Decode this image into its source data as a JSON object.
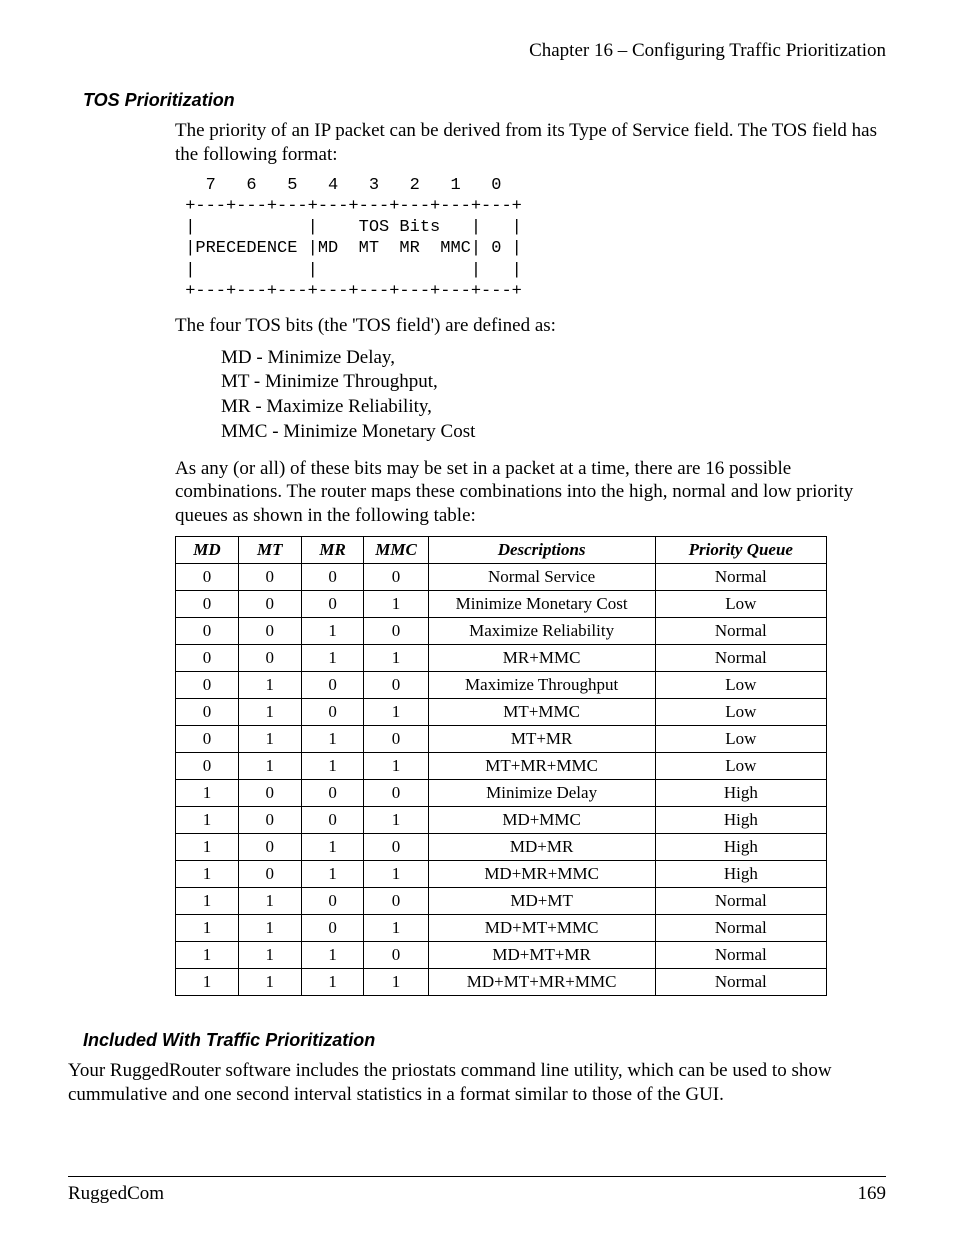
{
  "header": {
    "chapter": "Chapter 16 – Configuring Traffic Prioritization"
  },
  "section1": {
    "title": "TOS Prioritization",
    "p1": "The priority of an IP packet can be derived from its Type of Service field. The TOS field has the following format:",
    "ascii": "   7   6   5   4   3   2   1   0\n +---+---+---+---+---+---+---+---+\n |           |    TOS Bits   |   |\n |PRECEDENCE |MD  MT  MR  MMC| 0 |\n |           |               |   |\n +---+---+---+---+---+---+---+---+",
    "p2": "The four TOS bits (the 'TOS field') are defined as:",
    "defs": {
      "l1": "MD - Minimize Delay,",
      "l2": "MT - Minimize Throughput,",
      "l3": "MR - Maximize Reliability,",
      "l4": "MMC - Minimize Monetary Cost"
    },
    "p3": "As any (or all) of these bits may be set in a packet at a time, there are 16 possible combinations.  The router maps these combinations into the high, normal and low priority queues as shown in the following table:"
  },
  "table": {
    "headers": {
      "md": "MD",
      "mt": "MT",
      "mr": "MR",
      "mmc": "MMC",
      "desc": "Descriptions",
      "pq": "Priority Queue"
    },
    "rows": [
      {
        "md": "0",
        "mt": "0",
        "mr": "0",
        "mmc": "0",
        "desc": "Normal Service",
        "pq": "Normal"
      },
      {
        "md": "0",
        "mt": "0",
        "mr": "0",
        "mmc": "1",
        "desc": "Minimize Monetary Cost",
        "pq": "Low"
      },
      {
        "md": "0",
        "mt": "0",
        "mr": "1",
        "mmc": "0",
        "desc": "Maximize Reliability",
        "pq": "Normal"
      },
      {
        "md": "0",
        "mt": "0",
        "mr": "1",
        "mmc": "1",
        "desc": "MR+MMC",
        "pq": "Normal"
      },
      {
        "md": "0",
        "mt": "1",
        "mr": "0",
        "mmc": "0",
        "desc": "Maximize Throughput",
        "pq": "Low"
      },
      {
        "md": "0",
        "mt": "1",
        "mr": "0",
        "mmc": "1",
        "desc": "MT+MMC",
        "pq": "Low"
      },
      {
        "md": "0",
        "mt": "1",
        "mr": "1",
        "mmc": "0",
        "desc": "MT+MR",
        "pq": "Low"
      },
      {
        "md": "0",
        "mt": "1",
        "mr": "1",
        "mmc": "1",
        "desc": "MT+MR+MMC",
        "pq": "Low"
      },
      {
        "md": "1",
        "mt": "0",
        "mr": "0",
        "mmc": "0",
        "desc": "Minimize Delay",
        "pq": "High"
      },
      {
        "md": "1",
        "mt": "0",
        "mr": "0",
        "mmc": "1",
        "desc": "MD+MMC",
        "pq": "High"
      },
      {
        "md": "1",
        "mt": "0",
        "mr": "1",
        "mmc": "0",
        "desc": "MD+MR",
        "pq": "High"
      },
      {
        "md": "1",
        "mt": "0",
        "mr": "1",
        "mmc": "1",
        "desc": "MD+MR+MMC",
        "pq": "High"
      },
      {
        "md": "1",
        "mt": "1",
        "mr": "0",
        "mmc": "0",
        "desc": "MD+MT",
        "pq": "Normal"
      },
      {
        "md": "1",
        "mt": "1",
        "mr": "0",
        "mmc": "1",
        "desc": "MD+MT+MMC",
        "pq": "Normal"
      },
      {
        "md": "1",
        "mt": "1",
        "mr": "1",
        "mmc": "0",
        "desc": "MD+MT+MR",
        "pq": "Normal"
      },
      {
        "md": "1",
        "mt": "1",
        "mr": "1",
        "mmc": "1",
        "desc": "MD+MT+MR+MMC",
        "pq": "Normal"
      }
    ]
  },
  "section2": {
    "title": "Included With Traffic Prioritization",
    "p1": "Your RuggedRouter software includes the priostats command line utility, which can be used to show cummulative and one second interval statistics in a format similar to those of the GUI."
  },
  "footer": {
    "left": "RuggedCom",
    "right": "169"
  }
}
